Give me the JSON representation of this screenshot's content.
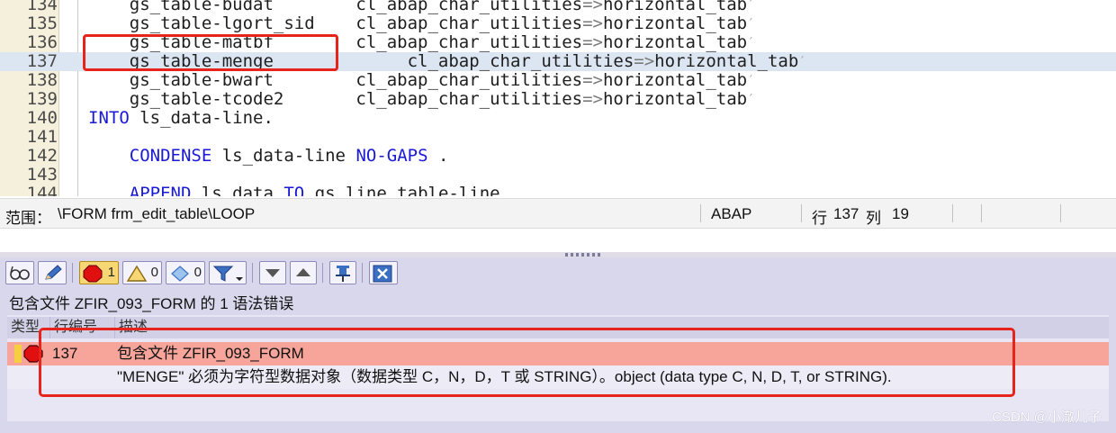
{
  "editor": {
    "lines": [
      {
        "num": "134",
        "parts": [
          {
            "t": "    gs_table-budat        cl_abap_char_utilities",
            "c": "plain"
          },
          {
            "t": "=>",
            "c": "op"
          },
          {
            "t": "horizontal_tab",
            "c": "plain"
          },
          {
            "t": "´",
            "c": "mark"
          }
        ]
      },
      {
        "num": "135",
        "parts": [
          {
            "t": "    gs_table-lgort_sid    cl_abap_char_utilities",
            "c": "plain"
          },
          {
            "t": "=>",
            "c": "op"
          },
          {
            "t": "horizontal_tab",
            "c": "plain"
          },
          {
            "t": "´",
            "c": "mark"
          }
        ]
      },
      {
        "num": "136",
        "parts": [
          {
            "t": "    gs_table-matbf        cl_abap_char_utilities",
            "c": "plain"
          },
          {
            "t": "=>",
            "c": "op"
          },
          {
            "t": "horizontal_tab",
            "c": "plain"
          },
          {
            "t": "´",
            "c": "mark"
          }
        ]
      },
      {
        "num": "137",
        "current": true,
        "parts": [
          {
            "t": "    gs_table-menge             cl_abap_char_utilities",
            "c": "plain"
          },
          {
            "t": "=>",
            "c": "op"
          },
          {
            "t": "horizontal_tab",
            "c": "plain"
          },
          {
            "t": "´",
            "c": "mark"
          }
        ]
      },
      {
        "num": "138",
        "parts": [
          {
            "t": "    gs_table-bwart        cl_abap_char_utilities",
            "c": "plain"
          },
          {
            "t": "=>",
            "c": "op"
          },
          {
            "t": "horizontal_tab",
            "c": "plain"
          },
          {
            "t": "´",
            "c": "mark"
          }
        ]
      },
      {
        "num": "139",
        "parts": [
          {
            "t": "    gs_table-tcode2       cl_abap_char_utilities",
            "c": "plain"
          },
          {
            "t": "=>",
            "c": "op"
          },
          {
            "t": "horizontal_tab",
            "c": "plain"
          },
          {
            "t": "´",
            "c": "mark"
          }
        ]
      },
      {
        "num": "140",
        "parts": [
          {
            "t": "INTO",
            "c": "kw"
          },
          {
            "t": " ls_data-line.",
            "c": "plain"
          }
        ]
      },
      {
        "num": "141",
        "parts": []
      },
      {
        "num": "142",
        "parts": [
          {
            "t": "    ",
            "c": "plain"
          },
          {
            "t": "CONDENSE",
            "c": "kw"
          },
          {
            "t": " ls_data-line ",
            "c": "plain"
          },
          {
            "t": "NO-GAPS",
            "c": "kw"
          },
          {
            "t": " .",
            "c": "plain"
          }
        ]
      },
      {
        "num": "143",
        "parts": []
      },
      {
        "num": "144",
        "parts": [
          {
            "t": "    ",
            "c": "plain"
          },
          {
            "t": "APPEND",
            "c": "kw"
          },
          {
            "t": " ls_data ",
            "c": "plain"
          },
          {
            "t": "TO",
            "c": "kw"
          },
          {
            "t": " gs_line_table-line",
            "c": "plain"
          }
        ]
      }
    ]
  },
  "statusbar": {
    "scope_label": "范围：",
    "scope_value": "\\FORM frm_edit_table\\LOOP",
    "language": "ABAP",
    "row_label": "行",
    "row_value": "137",
    "col_label": "列",
    "col_value": "19"
  },
  "toolbar": {
    "error_count": "1",
    "warning_count": "0",
    "info_count": "0"
  },
  "summary": "包含文件 ZFIR_093_FORM 的 1 语法错误",
  "error_table": {
    "columns": [
      "类型",
      "行编号",
      "描述"
    ],
    "rows": [
      {
        "line": "137",
        "description": "包含文件 ZFIR_093_FORM"
      },
      {
        "line": "",
        "description": "\"MENGE\" 必须为字符型数据对象（数据类型 C，N，D，T 或 STRING）。object (data type C, N, D, T, or STRING)."
      }
    ]
  },
  "watermark": "CSDN @小澈儿子",
  "colors": {
    "keyword": "#1a1ad4",
    "current_line": "#dce6f2",
    "error_row": "#f7a49a",
    "highlight_box": "#e6241c",
    "panel_bg": "#d9d7ec"
  }
}
